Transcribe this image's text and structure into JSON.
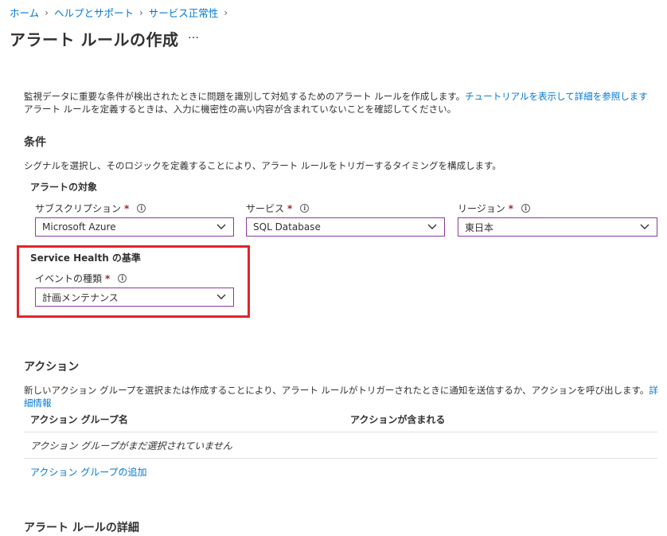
{
  "breadcrumb": [
    {
      "label": "ホーム"
    },
    {
      "label": "ヘルプとサポート"
    },
    {
      "label": "サービス正常性"
    }
  ],
  "breadcrumb_sep": "›",
  "page_title": "アラート ルールの作成",
  "more_label": "…",
  "intro": {
    "line1_text": "監視データに重要な条件が検出されたときに問題を識別して対処するためのアラート ルールを作成します。",
    "line1_link": "チュートリアルを表示して詳細を参照します",
    "line2_text": "アラート ルールを定義するときは、入力に機密性の高い内容が含まれていないことを確認してください。"
  },
  "conditions": {
    "title": "条件",
    "description": "シグナルを選択し、そのロジックを定義することにより、アラート ルールをトリガーするタイミングを構成します。",
    "target_title": "アラートの対象",
    "subscription": {
      "label": "サブスクリプション",
      "required": "*",
      "value": "Microsoft Azure"
    },
    "service": {
      "label": "サービス",
      "required": "*",
      "value": "SQL Database"
    },
    "region": {
      "label": "リージョン",
      "required": "*",
      "value": "東日本"
    },
    "service_health_title": "Service Health の基準",
    "event_type": {
      "label": "イベントの種類",
      "required": "*",
      "value": "計画メンテナンス"
    }
  },
  "info_glyph": "i",
  "actions": {
    "title": "アクション",
    "description": "新しいアクション グループを選択または作成することにより、アラート ルールがトリガーされたときに通知を送信するか、アクションを呼び出します。",
    "description_link": "詳細情報",
    "col_group_name": "アクション グループ名",
    "col_contains": "アクションが含まれる",
    "empty_message": "アクション グループがまだ選択されていません",
    "add_link": "アクション グループの追加"
  },
  "details": {
    "title": "アラート ルールの詳細"
  },
  "colors": {
    "link": "#0078d4",
    "select_border": "#8a3c9c",
    "highlight": "#e3242b",
    "required": "#a4262c"
  }
}
